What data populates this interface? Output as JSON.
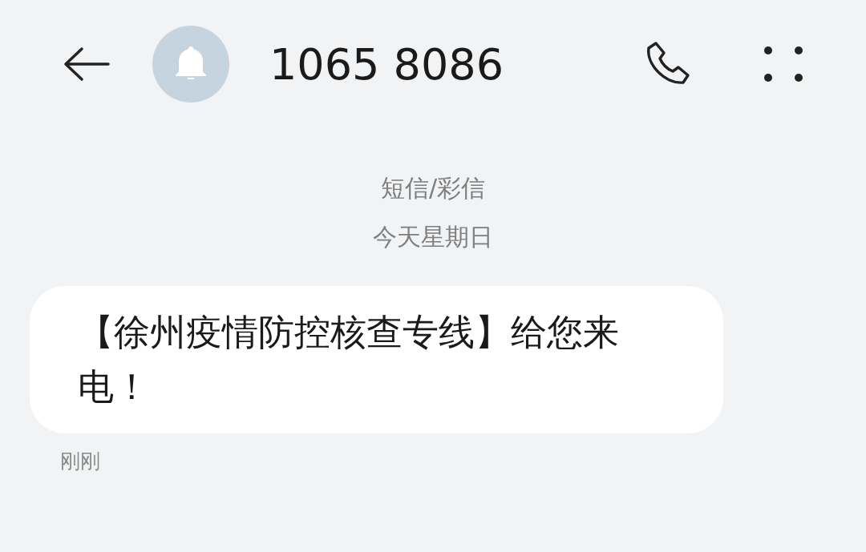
{
  "header": {
    "title": "1065 8086"
  },
  "thread_info": {
    "channel": "短信/彩信",
    "date": "今天星期日"
  },
  "messages": [
    {
      "text": "【徐州疫情防控核查专线】给您来电！",
      "time": "刚刚"
    }
  ]
}
